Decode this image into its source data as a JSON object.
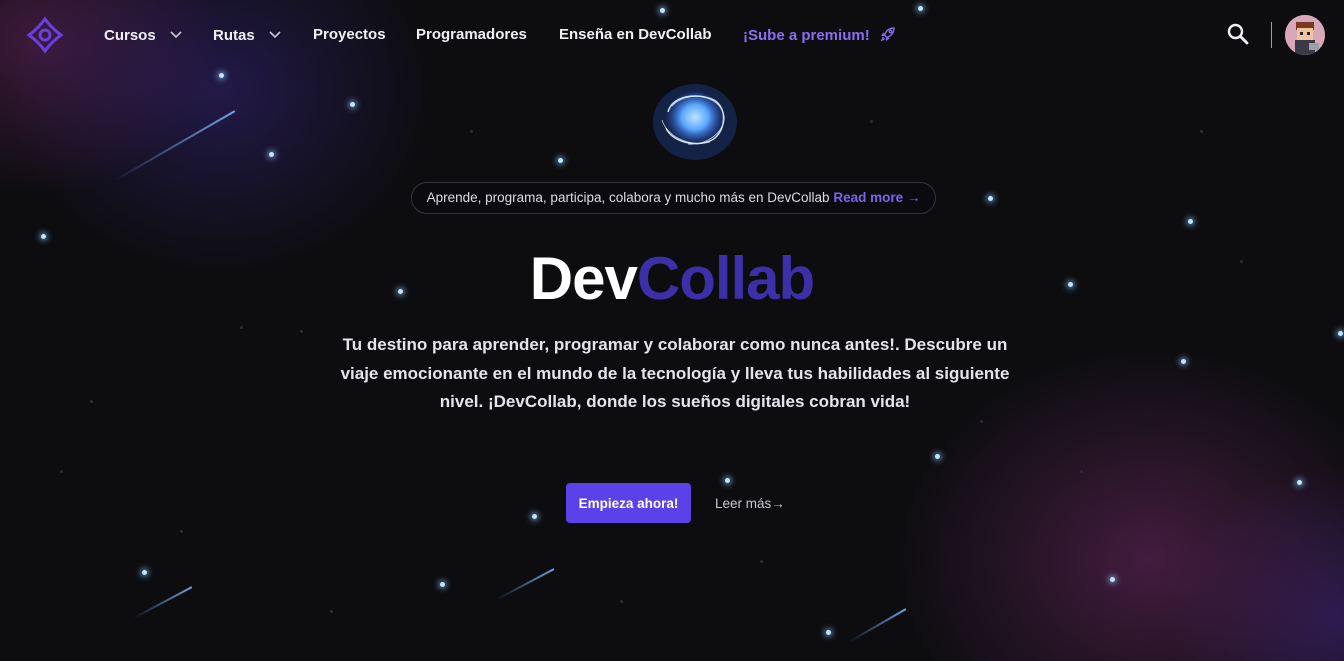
{
  "nav": {
    "items": [
      {
        "label": "Cursos",
        "dropdown": true
      },
      {
        "label": "Rutas",
        "dropdown": true
      },
      {
        "label": "Proyectos",
        "dropdown": false
      },
      {
        "label": "Programadores",
        "dropdown": false
      },
      {
        "label": "Enseña en DevCollab",
        "dropdown": false
      }
    ],
    "premium_label": "¡Sube a premium!",
    "icons": {
      "logo": "devcollab-logo",
      "search": "search-icon",
      "premium": "rocket-icon",
      "chevron": "chevron-down-icon",
      "avatar": "avatar"
    }
  },
  "hero": {
    "announcement_text": "Aprende, programa, participa, colabora y mucho más en DevCollab",
    "announcement_link": "Read more →",
    "brand_dev": "Dev",
    "brand_collab": "Collab",
    "tagline": "Tu destino para aprender, programar y colaborar como nunca antes!. Descubre un viaje emocionante en el mundo de la tecnología y lleva tus habilidades al siguiente nivel. ¡DevCollab, donde los sueños digitales cobran vida!",
    "primary_cta": "Empieza ahora!",
    "secondary_cta": "Leer más→"
  },
  "colors": {
    "background": "#0d0d10",
    "accent": "#5b42e8",
    "premium": "#8b6cf6",
    "brand_collab": "#3d2fa8",
    "star": "#bfe6ff"
  }
}
